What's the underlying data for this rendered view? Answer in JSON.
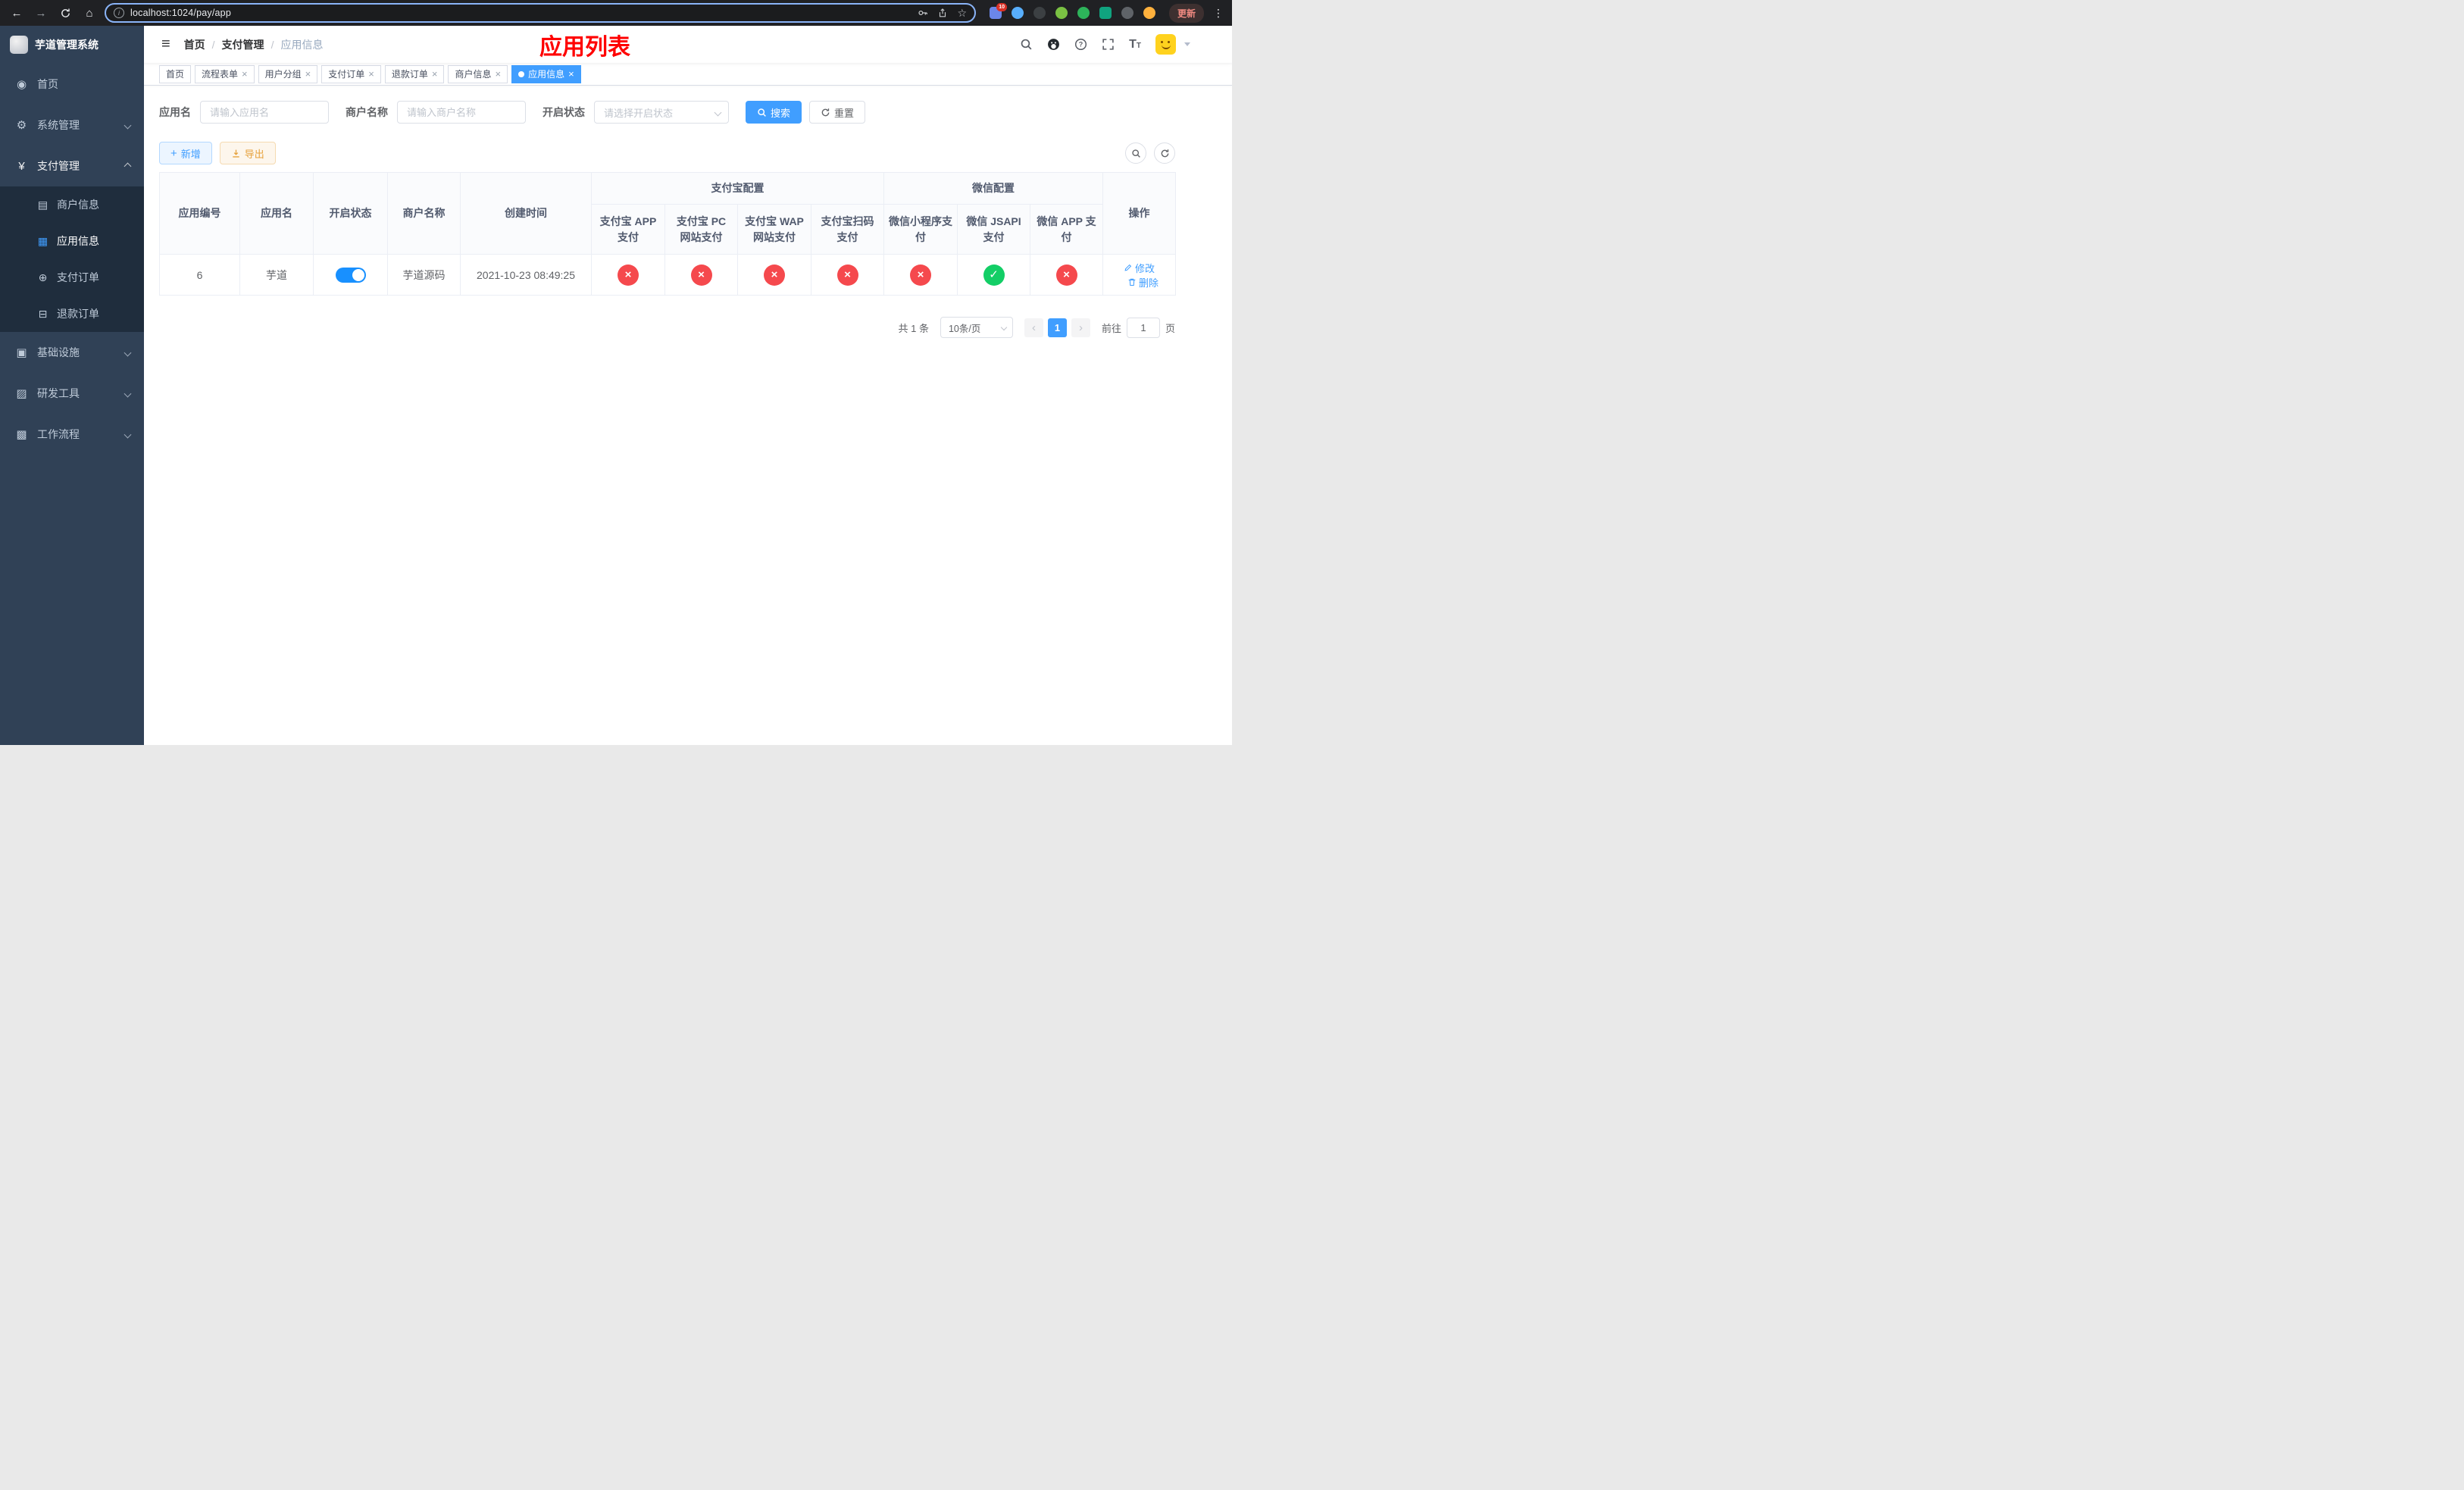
{
  "colors": {
    "accent": "#409eff",
    "switch_on": "#1890ff",
    "danger": "#f5494d",
    "success": "#13ce66",
    "title": "#ff0000",
    "sidebar_bg": "#304156",
    "sidebar_sub_bg": "#1f2d3d",
    "chrome_bg": "#202124"
  },
  "browser": {
    "url": "localhost:1024/pay/app",
    "update_label": "更新",
    "extension_badge": "10"
  },
  "sidebar": {
    "app_title": "芋道管理系统",
    "items": [
      {
        "label": "首页"
      },
      {
        "label": "系统管理"
      },
      {
        "label": "支付管理"
      },
      {
        "label": "基础设施"
      },
      {
        "label": "研发工具"
      },
      {
        "label": "工作流程"
      }
    ],
    "payment_children": [
      {
        "label": "商户信息"
      },
      {
        "label": "应用信息"
      },
      {
        "label": "支付订单"
      },
      {
        "label": "退款订单"
      }
    ]
  },
  "header": {
    "breadcrumb": [
      "首页",
      "支付管理",
      "应用信息"
    ],
    "page_title": "应用列表"
  },
  "tabs": [
    {
      "label": "首页"
    },
    {
      "label": "流程表单"
    },
    {
      "label": "用户分组"
    },
    {
      "label": "支付订单"
    },
    {
      "label": "退款订单"
    },
    {
      "label": "商户信息"
    },
    {
      "label": "应用信息"
    }
  ],
  "filters": {
    "app_name_label": "应用名",
    "app_name_placeholder": "请输入应用名",
    "merchant_label": "商户名称",
    "merchant_placeholder": "请输入商户名称",
    "status_label": "开启状态",
    "status_placeholder": "请选择开启状态",
    "search_label": "搜索",
    "reset_label": "重置"
  },
  "toolbar": {
    "add_label": "新增",
    "export_label": "导出"
  },
  "table": {
    "groups": {
      "alipay": "支付宝配置",
      "wechat": "微信配置"
    },
    "columns": {
      "app_id": "应用编号",
      "app_name": "应用名",
      "status": "开启状态",
      "merchant": "商户名称",
      "created": "创建时间",
      "alipay_app": "支付宝 APP 支付",
      "alipay_pc": "支付宝 PC 网站支付",
      "alipay_wap": "支付宝 WAP 网站支付",
      "alipay_qr": "支付宝扫码支付",
      "wx_lite": "微信小程序支付",
      "wx_jsapi": "微信 JSAPI 支付",
      "wx_app": "微信 APP 支付",
      "actions": "操作"
    },
    "row": {
      "app_id": "6",
      "app_name": "芋道",
      "enabled": true,
      "merchant": "芋道源码",
      "created": "2021-10-23 08:49:25",
      "alipay_app": false,
      "alipay_pc": false,
      "alipay_wap": false,
      "alipay_qr": false,
      "wx_lite": false,
      "wx_jsapi": true,
      "wx_app": false
    },
    "edit_label": "修改",
    "delete_label": "删除"
  },
  "pagination": {
    "total": "共 1 条",
    "page_size": "10条/页",
    "page": "1",
    "goto_label": "前往",
    "goto_value": "1",
    "goto_unit": "页"
  }
}
